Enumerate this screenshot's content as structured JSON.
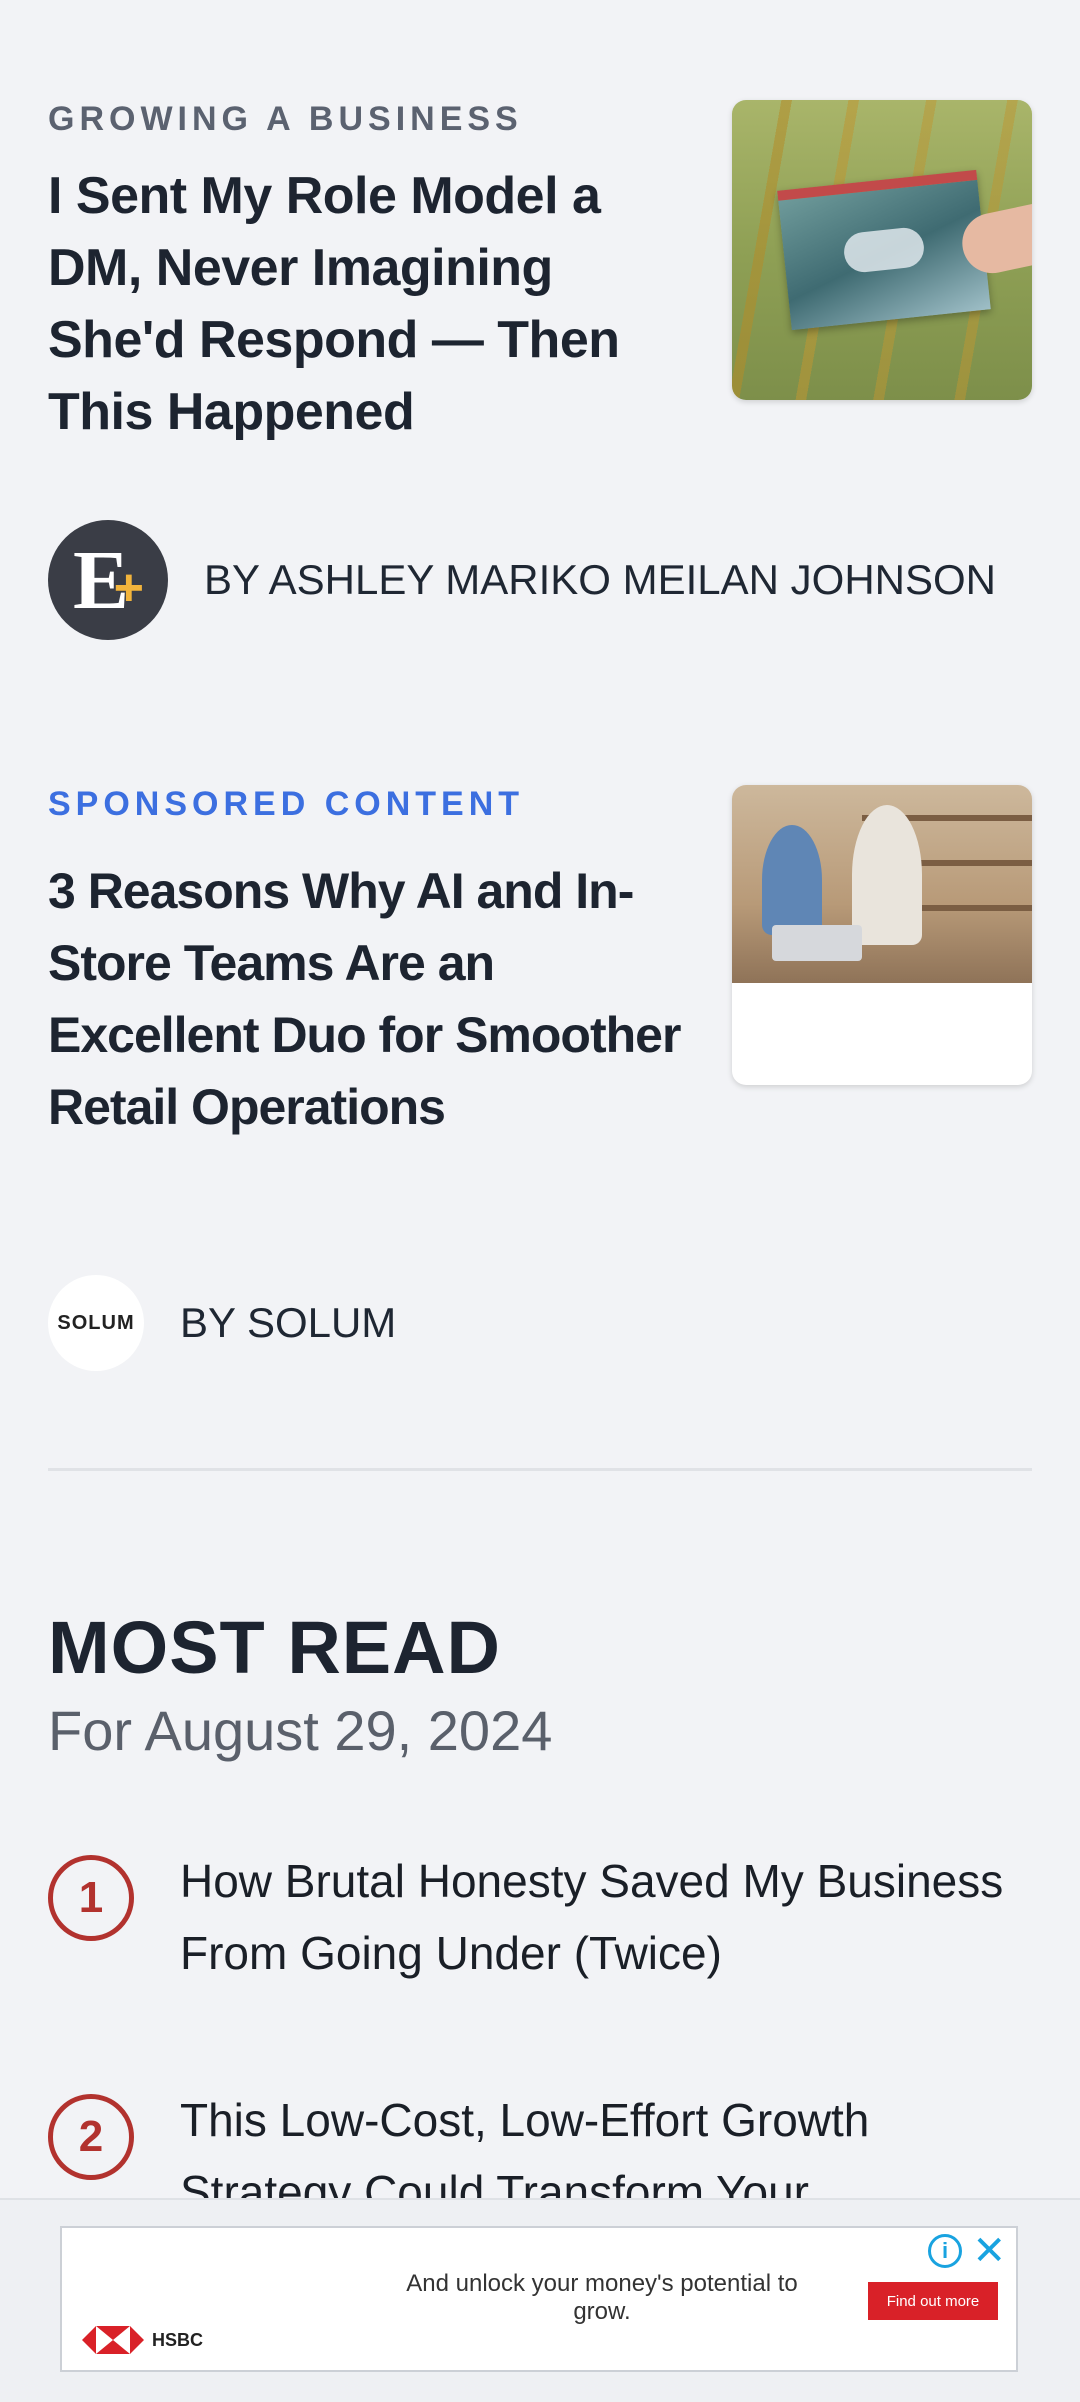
{
  "articles": [
    {
      "kicker": "GROWING A BUSINESS",
      "title": "I Sent My Role Model a DM, Never Imagining She'd Respond — Then This Happened",
      "byline": "BY ASHLEY MARIKO MEILAN JOHNSON",
      "logo_icon": "entrepreneur-plus-logo"
    },
    {
      "kicker": "SPONSORED CONTENT",
      "title": "3 Reasons Why AI and In-Store Teams Are an Excellent Duo for Smoother Retail Operations",
      "byline": "BY SOLUM",
      "logo_text": "SOLUM"
    }
  ],
  "most_read": {
    "title": "MOST READ",
    "date": "For August 29, 2024",
    "items": [
      {
        "rank": "1",
        "title": "How Brutal Honesty Saved My Business From Going Under (Twice)"
      },
      {
        "rank": "2",
        "title": "This Low-Cost, Low-Effort Growth Strategy Could Transform Your"
      }
    ]
  },
  "ad": {
    "text": "And unlock your money's potential to grow.",
    "cta": "Find out more",
    "brand": "HSBC",
    "info_icon": "info-icon",
    "close_icon": "close-icon"
  },
  "colors": {
    "background": "#f2f3f6",
    "sponsored_accent": "#3c6fe0",
    "rank_accent": "#b2322e",
    "ad_cta": "#d92128"
  }
}
